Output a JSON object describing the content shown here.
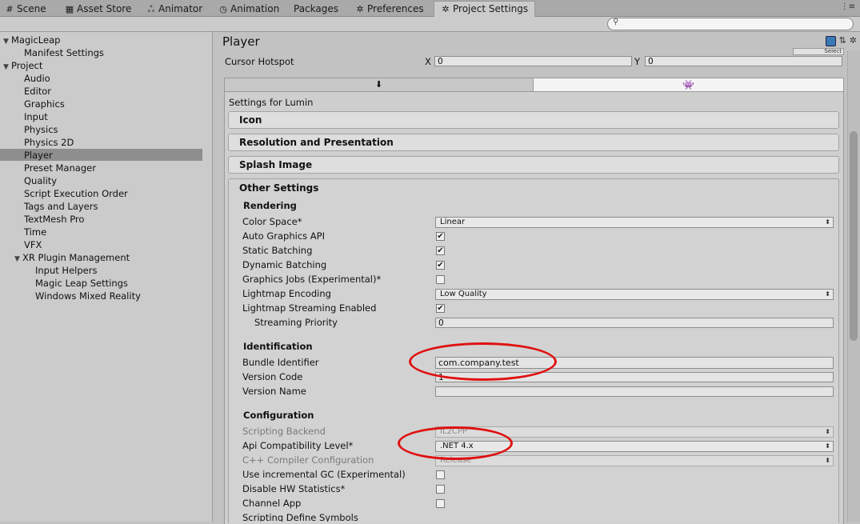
{
  "tabs": [
    {
      "icon": "#",
      "label": "Scene"
    },
    {
      "icon": "▦",
      "label": "Asset Store"
    },
    {
      "icon": "ஃ",
      "label": "Animator"
    },
    {
      "icon": "◷",
      "label": "Animation"
    },
    {
      "icon": "",
      "label": "Packages"
    },
    {
      "icon": "✲",
      "label": "Preferences"
    },
    {
      "icon": "✲",
      "label": "Project Settings"
    }
  ],
  "tab_menu_glyph": "⋮≡",
  "tree": {
    "magicleap": "MagicLeap",
    "manifest_settings": "Manifest Settings",
    "project": "Project",
    "audio": "Audio",
    "editor": "Editor",
    "graphics": "Graphics",
    "input": "Input",
    "physics": "Physics",
    "physics2d": "Physics 2D",
    "player": "Player",
    "preset_manager": "Preset Manager",
    "quality": "Quality",
    "script_execution_order": "Script Execution Order",
    "tags_and_layers": "Tags and Layers",
    "textmesh_pro": "TextMesh Pro",
    "time": "Time",
    "vfx": "VFX",
    "xr_plugin_management": "XR Plugin Management",
    "input_helpers": "Input Helpers",
    "magic_leap_settings": "Magic Leap Settings",
    "windows_mixed_reality": "Windows Mixed Reality"
  },
  "header": {
    "title": "Player",
    "select_label": "Select"
  },
  "cursor": {
    "label": "Cursor Hotspot",
    "x_label": "X",
    "x_value": "0",
    "y_label": "Y",
    "y_value": "0"
  },
  "platform": {
    "left_glyph": "⬇",
    "right_glyph": "👾"
  },
  "settings_for": "Settings for Lumin",
  "sections": {
    "icon": "Icon",
    "resolution": "Resolution and Presentation",
    "splash": "Splash Image",
    "other": "Other Settings"
  },
  "rendering": {
    "heading": "Rendering",
    "color_space_label": "Color Space*",
    "color_space_value": "Linear",
    "auto_graphics_api": "Auto Graphics API",
    "static_batching": "Static Batching",
    "dynamic_batching": "Dynamic Batching",
    "graphics_jobs": "Graphics Jobs (Experimental)*",
    "lightmap_encoding_label": "Lightmap Encoding",
    "lightmap_encoding_value": "Low Quality",
    "lightmap_streaming": "Lightmap Streaming Enabled",
    "streaming_priority_label": "Streaming Priority",
    "streaming_priority_value": "0"
  },
  "checks": {
    "auto_graphics_api": true,
    "static_batching": true,
    "dynamic_batching": true,
    "graphics_jobs": false,
    "lightmap_streaming": true,
    "incremental_gc": false,
    "disable_hw_stats": false,
    "channel_app": false
  },
  "identification": {
    "heading": "Identification",
    "bundle_label": "Bundle Identifier",
    "bundle_value": "com.company.test",
    "version_code_label": "Version Code",
    "version_code_value": "1",
    "version_name_label": "Version Name",
    "version_name_value": ""
  },
  "configuration": {
    "heading": "Configuration",
    "scripting_backend_label": "Scripting Backend",
    "scripting_backend_value": "IL2CPP",
    "api_level_label": "Api Compatibility Level*",
    "api_level_value": ".NET 4.x",
    "cpp_config_label": "C++ Compiler Configuration",
    "cpp_config_value": "Release",
    "incremental_gc": "Use incremental GC (Experimental)",
    "disable_hw_stats": "Disable HW Statistics*",
    "channel_app": "Channel App",
    "scripting_define": "Scripting Define Symbols"
  },
  "colors": {
    "annotation_red": "#e01010",
    "selected_row": "#8e8e8e",
    "lumin_icon": "#c8252a"
  }
}
